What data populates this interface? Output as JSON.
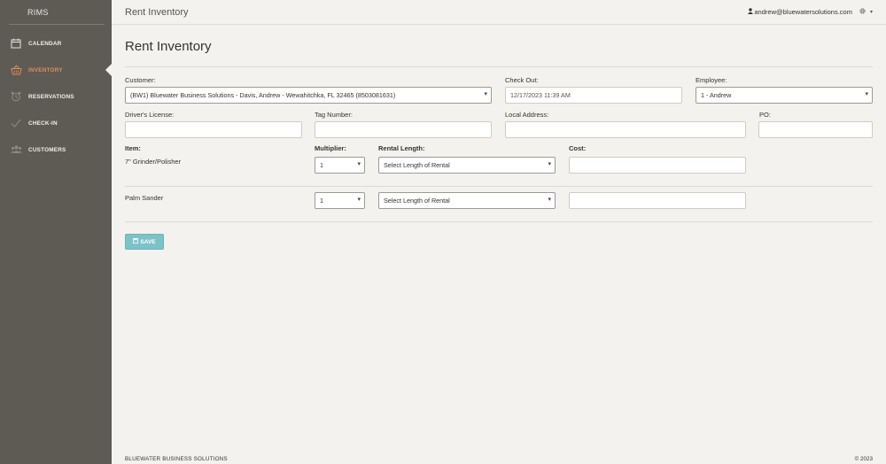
{
  "app": {
    "brand": "RIMS",
    "page_title": "Rent Inventory"
  },
  "sidebar": {
    "items": [
      {
        "label": "CALENDAR",
        "icon": "calendar-icon",
        "active": false
      },
      {
        "label": "INVENTORY",
        "icon": "basket-icon",
        "active": true
      },
      {
        "label": "RESERVATIONS",
        "icon": "alarm-clock-icon",
        "active": false
      },
      {
        "label": "CHECK-IN",
        "icon": "checkmark-icon",
        "active": false
      },
      {
        "label": "CUSTOMERS",
        "icon": "users-icon",
        "active": false
      }
    ]
  },
  "header": {
    "title": "Rent Inventory",
    "user_email": "andrew@bluewatersolutions.com"
  },
  "form": {
    "customer_label": "Customer:",
    "customer_value": "(BW1) Bluewater Business Solutions - Davis, Andrew - Wewahitchka, FL 32465 (8503081631)",
    "checkout_label": "Check Out:",
    "checkout_value": "12/17/2023 11:39 AM",
    "employee_label": "Employee:",
    "employee_value": "1 - Andrew",
    "license_label": "Driver's License:",
    "license_value": "",
    "tag_label": "Tag Number:",
    "tag_value": "",
    "address_label": "Local Address:",
    "address_value": "",
    "po_label": "PO:",
    "po_value": ""
  },
  "items_table": {
    "headers": {
      "item": "Item:",
      "multiplier": "Multiplier:",
      "rental_length": "Rental Length:",
      "cost": "Cost:"
    },
    "rows": [
      {
        "item": "7\" Grinder/Polisher",
        "multiplier": "1",
        "rental_length": "Select Length of Rental",
        "cost": ""
      },
      {
        "item": "Palm Sander",
        "multiplier": "1",
        "rental_length": "Select Length of Rental",
        "cost": ""
      }
    ]
  },
  "actions": {
    "save_label": "SAVE"
  },
  "footer": {
    "company": "BLUEWATER BUSINESS SOLUTIONS",
    "copyright": "© 2023"
  },
  "colors": {
    "sidebar_bg": "#5e5b55",
    "page_bg": "#f3f2ee",
    "active_accent": "#e0895a",
    "save_button": "#7cc3c8"
  }
}
